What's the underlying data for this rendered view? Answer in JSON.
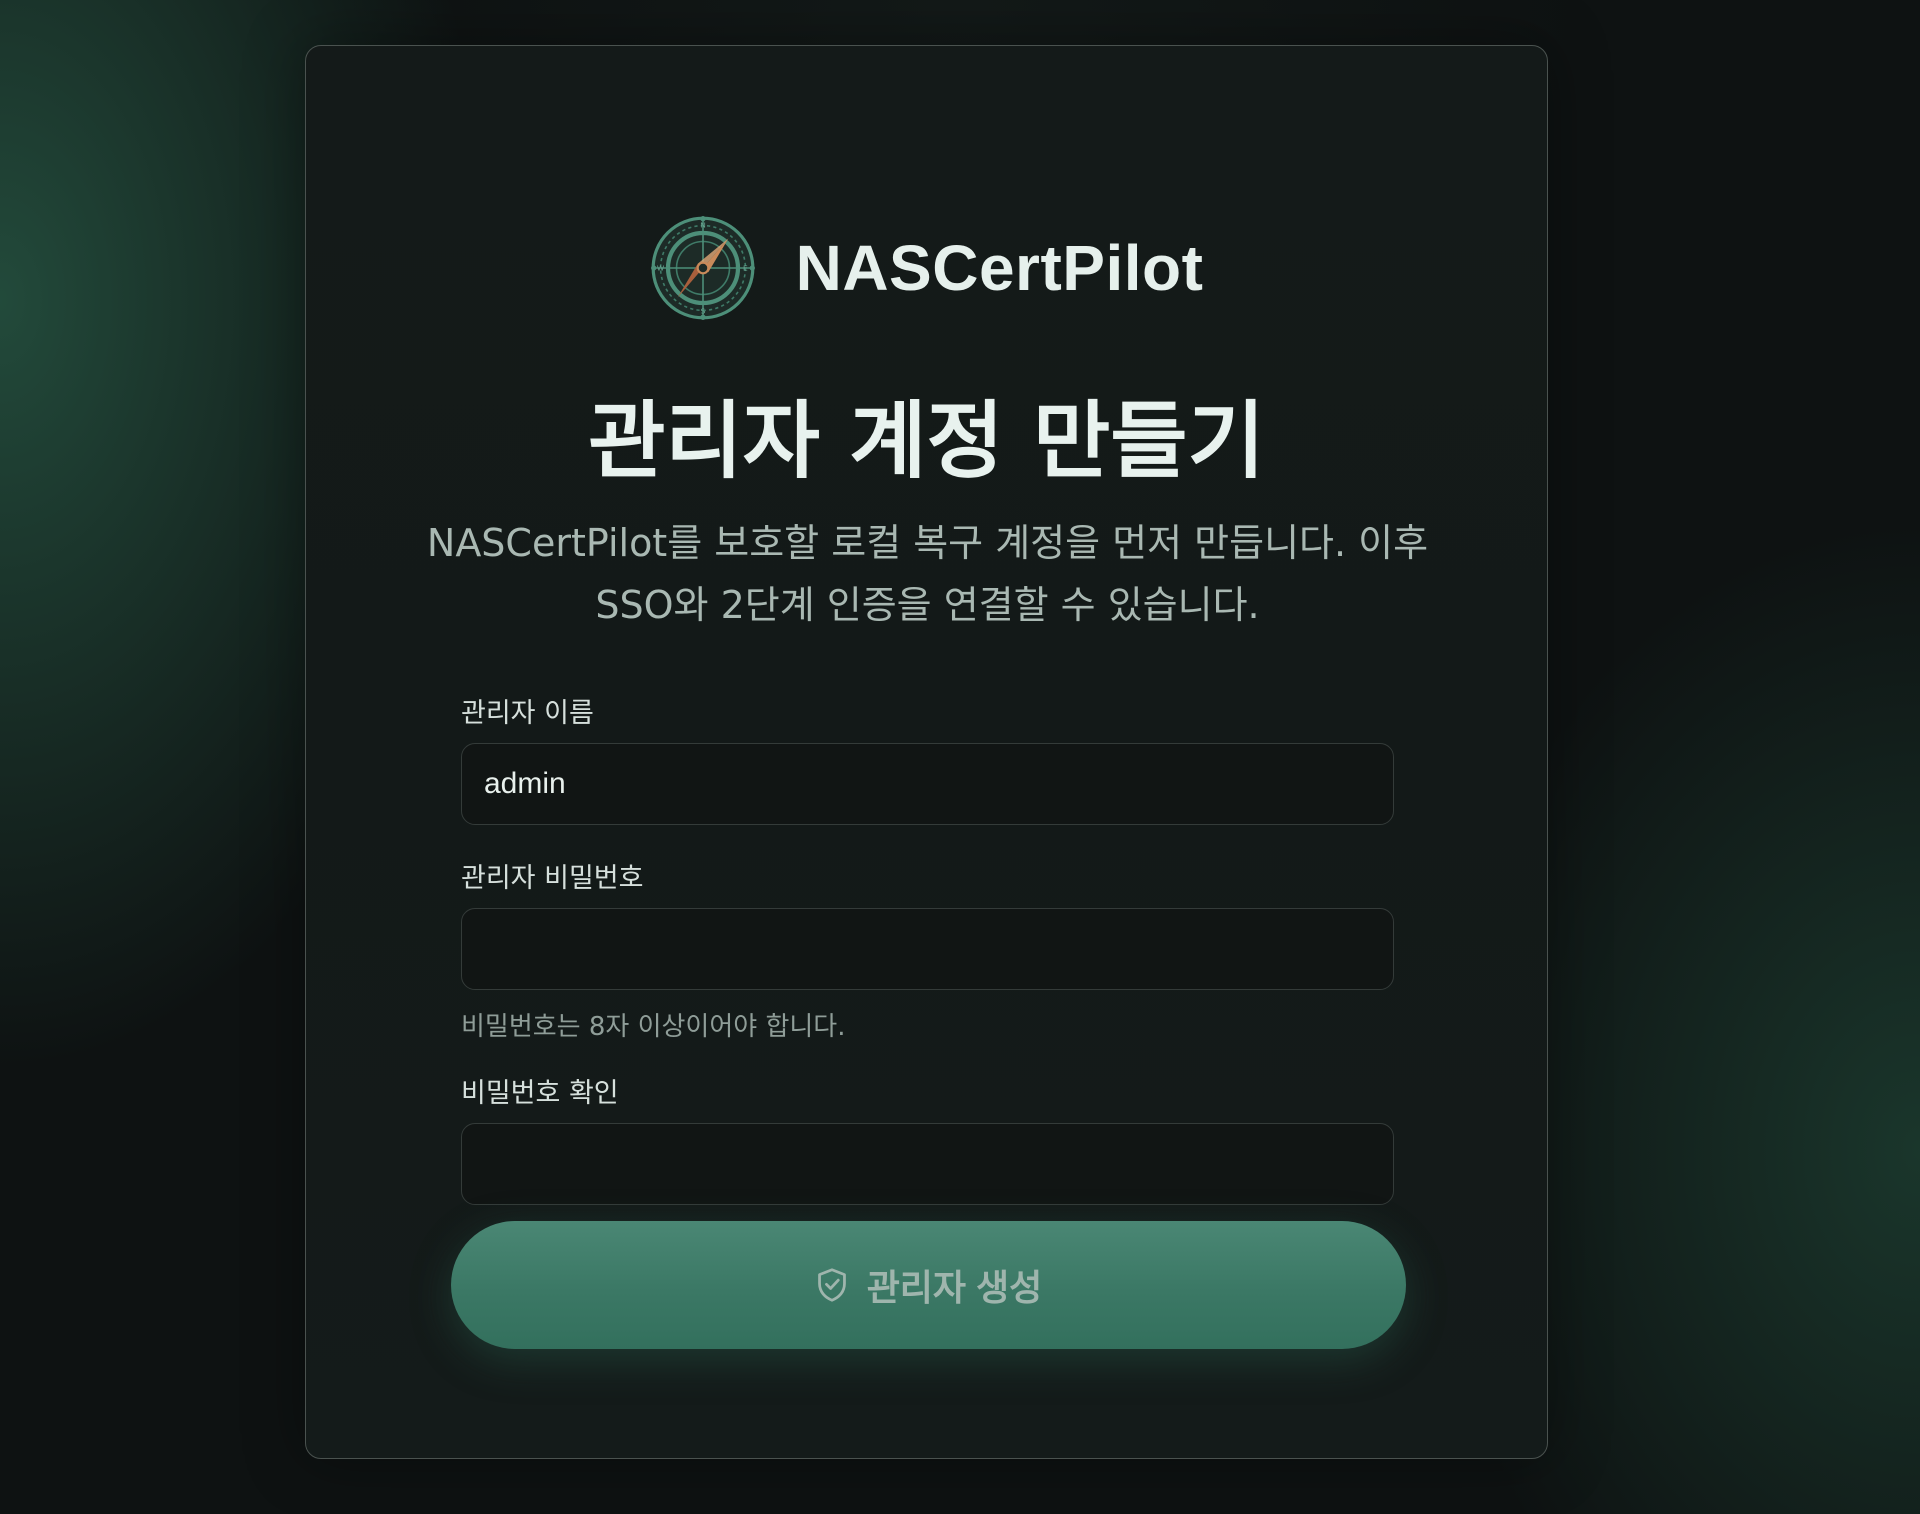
{
  "app": {
    "name": "NASCertPilot",
    "logo_icon": "compass-icon"
  },
  "setup": {
    "title": "관리자 계정 만들기",
    "description": "NASCertPilot를 보호할 로컬 복구 계정을 먼저 만듭니다. 이후 SSO와 2단계 인증을 연결할 수 있습니다."
  },
  "form": {
    "username": {
      "label": "관리자 이름",
      "value": "admin"
    },
    "password": {
      "label": "관리자 비밀번호",
      "value": "",
      "hint": "비밀번호는 8자 이상이어야 합니다."
    },
    "password_confirm": {
      "label": "비밀번호 확인",
      "value": ""
    },
    "submit": {
      "label": "관리자 생성",
      "icon": "shield-check-icon"
    }
  },
  "colors": {
    "accent": "#3b7865",
    "background": "#0e1212",
    "card": "#141a19"
  }
}
